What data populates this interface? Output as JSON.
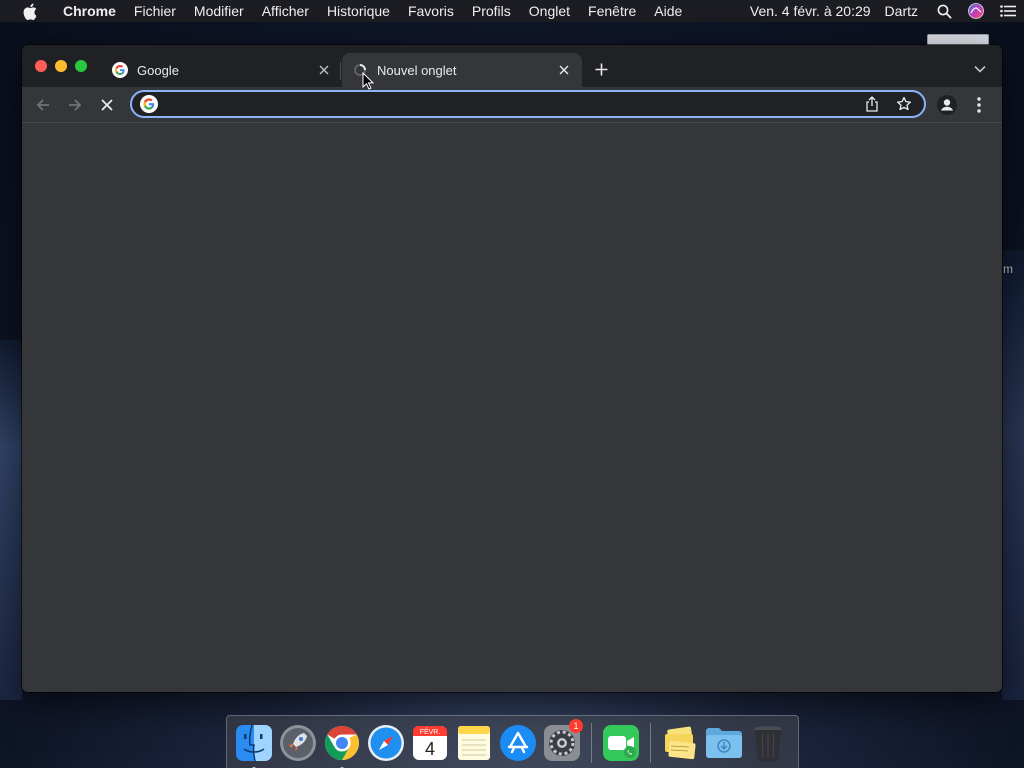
{
  "menubar": {
    "app_name": "Chrome",
    "items": [
      "Fichier",
      "Modifier",
      "Afficher",
      "Historique",
      "Favoris",
      "Profils",
      "Onglet",
      "Fenêtre",
      "Aide"
    ],
    "clock": "Ven. 4 févr. à  20:29",
    "user": "Dartz",
    "icons": [
      "apple-icon",
      "spotlight-search-icon",
      "siri-icon",
      "control-center-icon"
    ]
  },
  "desktop": {
    "edge_text": "m"
  },
  "browser": {
    "tabs": [
      {
        "title": "Google",
        "favicon": "google-g-icon",
        "active": false
      },
      {
        "title": "Nouvel onglet",
        "favicon": "loading-spinner-icon",
        "active": true
      }
    ],
    "omnibox": {
      "value": "",
      "placeholder": ""
    },
    "colors": {
      "frame": "#202124",
      "toolbar": "#35363a",
      "omnibox_focus": "#8ab4f8"
    }
  },
  "dock": {
    "apps": [
      {
        "name": "Finder",
        "icon": "finder-icon",
        "running": true
      },
      {
        "name": "Launchpad",
        "icon": "launchpad-icon",
        "running": false
      },
      {
        "name": "Google Chrome",
        "icon": "chrome-icon",
        "running": true
      },
      {
        "name": "Safari",
        "icon": "safari-icon",
        "running": false
      },
      {
        "name": "Calendrier",
        "icon": "calendar-icon",
        "running": false,
        "month": "FÉVR.",
        "day": "4"
      },
      {
        "name": "Notes",
        "icon": "notes-icon",
        "running": false
      },
      {
        "name": "App Store",
        "icon": "app-store-icon",
        "running": false
      },
      {
        "name": "Préférences Système",
        "icon": "system-preferences-icon",
        "running": false,
        "badge": "1"
      },
      {
        "name": "FaceTime",
        "icon": "facetime-icon",
        "running": false
      },
      {
        "name": "Documents",
        "icon": "stack-icon",
        "running": false
      },
      {
        "name": "Téléchargements",
        "icon": "downloads-folder-icon",
        "running": false
      },
      {
        "name": "Corbeille",
        "icon": "trash-icon",
        "running": false
      }
    ]
  }
}
